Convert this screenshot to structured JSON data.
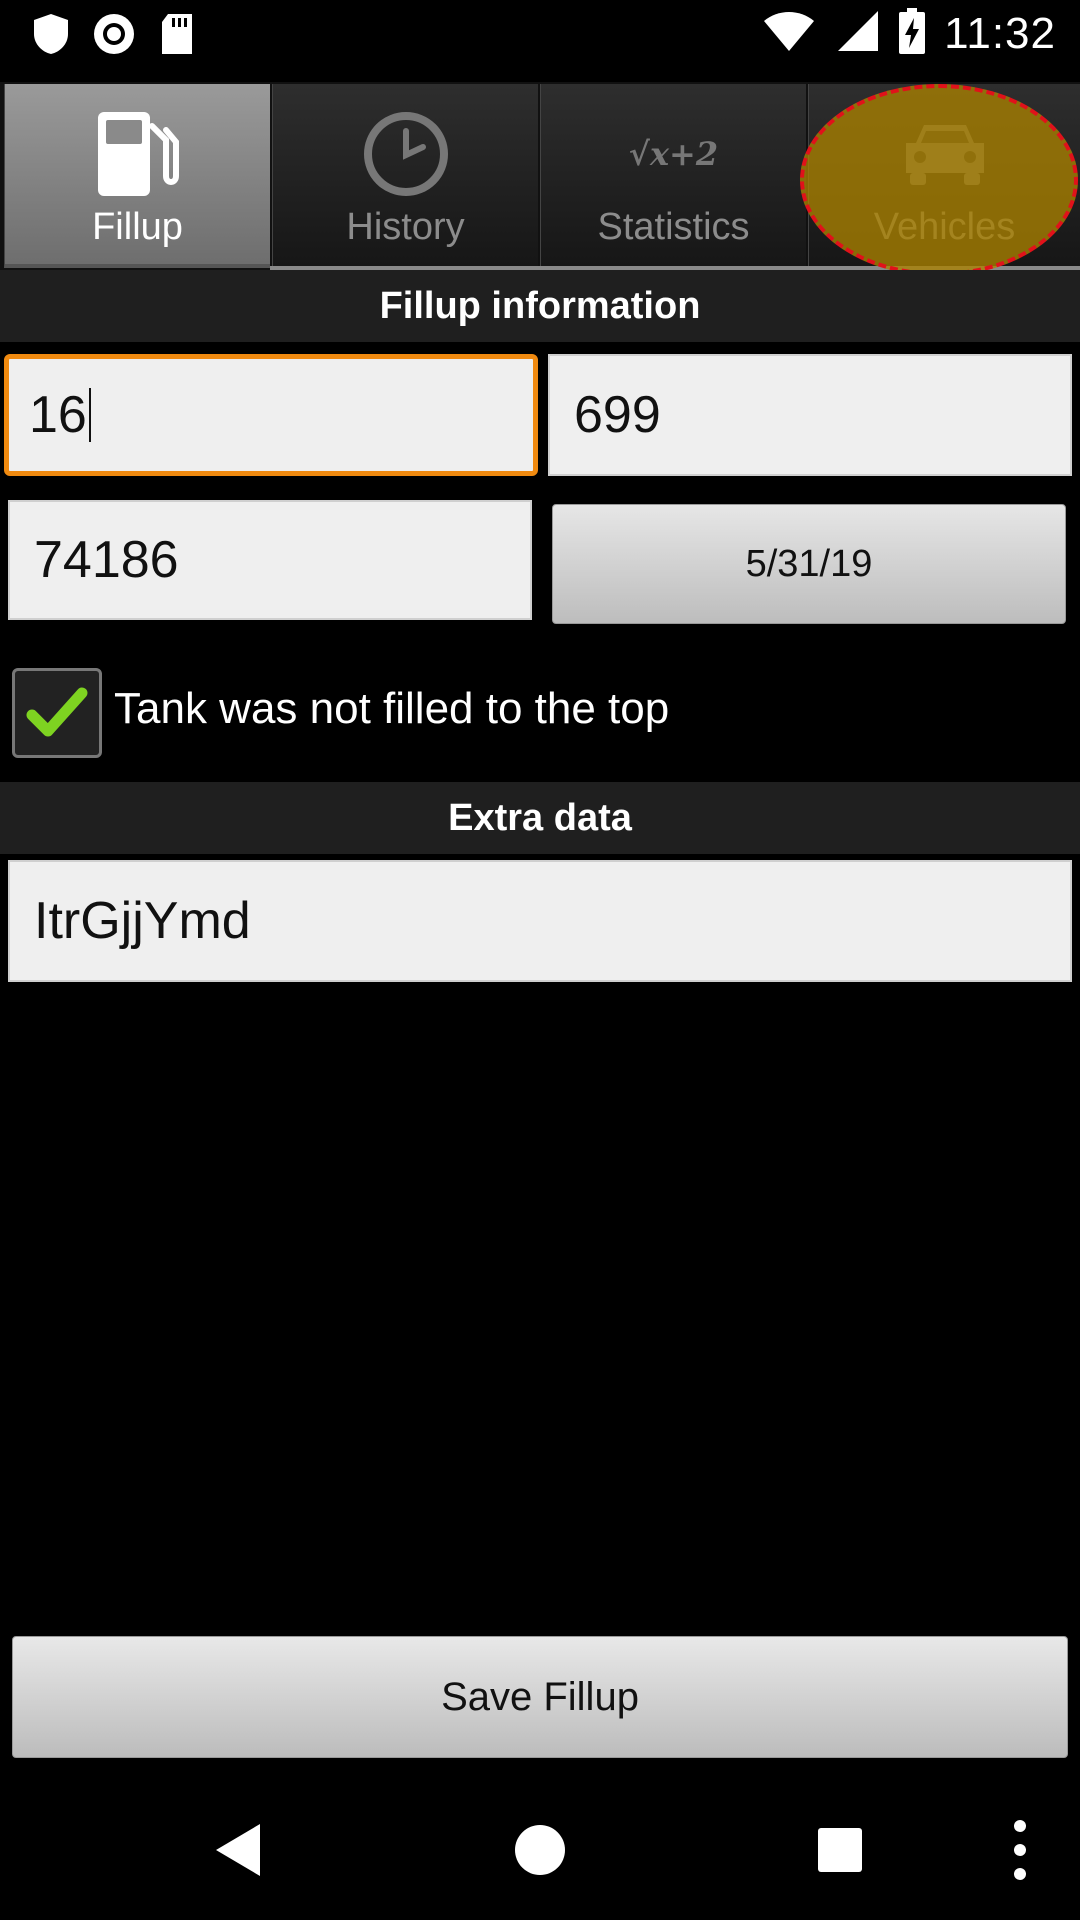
{
  "status_bar": {
    "time": "11:32",
    "left_icons": [
      "shield-icon",
      "record-icon",
      "sd-card-icon"
    ],
    "right_icons": [
      "wifi-icon",
      "cell-signal-icon",
      "battery-charging-icon"
    ]
  },
  "tabs": [
    {
      "label": "Fillup",
      "icon": "fuel-pump-icon",
      "active": true
    },
    {
      "label": "History",
      "icon": "clock-icon",
      "active": false
    },
    {
      "label": "Statistics",
      "icon": "formula-icon",
      "icon_text": "√x+2",
      "active": false
    },
    {
      "label": "Vehicles",
      "icon": "car-icon",
      "active": false
    }
  ],
  "fillup_section": {
    "header": "Fillup information",
    "field_1": "16",
    "field_2": "699",
    "field_3": "74186",
    "date_button": "5/31/19",
    "checkbox_label": "Tank was not filled to the top",
    "checkbox_checked": true
  },
  "extra_section": {
    "header": "Extra data",
    "field": "ItrGjjYmd"
  },
  "save_button": "Save Fillup",
  "colors": {
    "focus_border": "#f08a10",
    "check_green": "#7ed321",
    "highlight": "#aa8200",
    "highlight_border": "#e0121a"
  }
}
